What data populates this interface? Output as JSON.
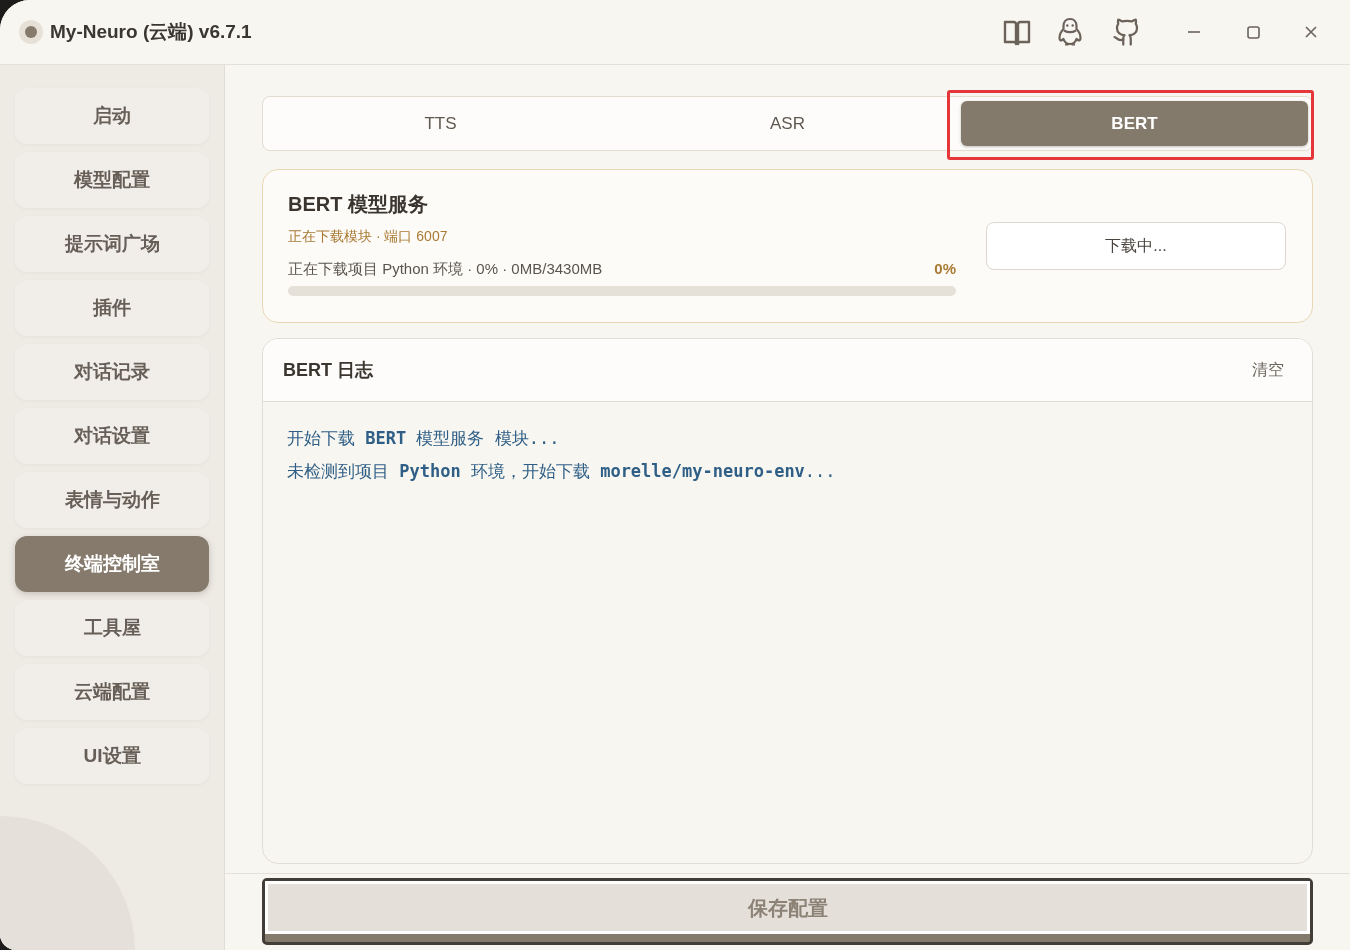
{
  "window": {
    "title": "My-Neuro (云端) v6.7.1"
  },
  "sidebar": {
    "items": [
      {
        "label": "启动",
        "selected": false
      },
      {
        "label": "模型配置",
        "selected": false
      },
      {
        "label": "提示词广场",
        "selected": false
      },
      {
        "label": "插件",
        "selected": false
      },
      {
        "label": "对话记录",
        "selected": false
      },
      {
        "label": "对话设置",
        "selected": false
      },
      {
        "label": "表情与动作",
        "selected": false
      },
      {
        "label": "终端控制室",
        "selected": true
      },
      {
        "label": "工具屋",
        "selected": false
      },
      {
        "label": "云端配置",
        "selected": false
      },
      {
        "label": "UI设置",
        "selected": false
      }
    ]
  },
  "tabs": [
    {
      "label": "TTS",
      "selected": false,
      "highlighted": false
    },
    {
      "label": "ASR",
      "selected": false,
      "highlighted": false
    },
    {
      "label": "BERT",
      "selected": true,
      "highlighted": true
    }
  ],
  "service": {
    "title": "BERT 模型服务",
    "status": "正在下载模块 · 端口 6007",
    "progress_text": "正在下载项目 Python 环境 · 0% · 0MB/3430MB",
    "percent": "0%",
    "level": 0,
    "button": "下载中..."
  },
  "log": {
    "title": "BERT 日志",
    "clear_button": "清空",
    "lines": [
      "开始下载 **BERT** 模型服务 模块...",
      "未检测到项目 **Python** 环境，开始下载 **morelle/my-neuro-env**..."
    ]
  },
  "footer": {
    "save_button": "保存配置"
  }
}
